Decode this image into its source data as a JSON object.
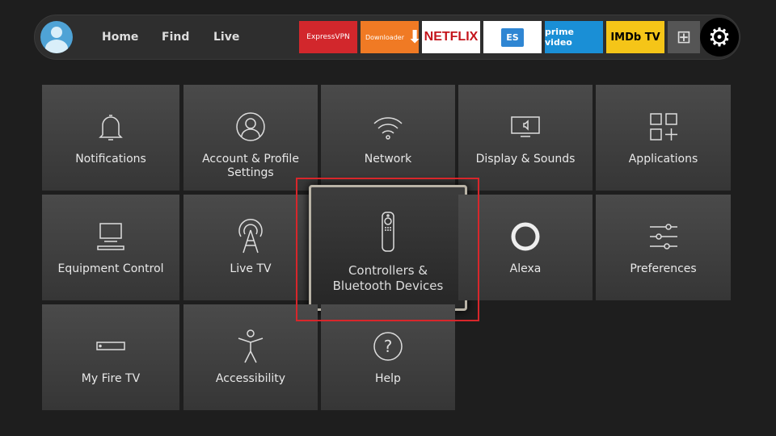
{
  "topbar": {
    "nav": [
      "Home",
      "Find",
      "Live"
    ],
    "apps": [
      {
        "label": "ExpressVPN",
        "bg": "#d2272c",
        "color": "#ffffff"
      },
      {
        "label": "Downloader",
        "bg": "#f07a24",
        "color": "#ffffff"
      },
      {
        "label": "NETFLIX",
        "bg": "#ffffff",
        "color": "#c4141b"
      },
      {
        "label": "ES",
        "bg": "#ffffff",
        "color": "#2f86d3"
      },
      {
        "label": "prime video",
        "bg": "#1a8fd6",
        "color": "#ffffff"
      },
      {
        "label": "IMDb TV",
        "bg": "#f5c518",
        "color": "#000000"
      }
    ],
    "app_grid_icon": "app-grid-plus-icon",
    "settings_icon": "gear-icon"
  },
  "tiles": [
    {
      "label": "Notifications",
      "icon": "bell-icon"
    },
    {
      "label": "Account & Profile Settings",
      "icon": "user-icon"
    },
    {
      "label": "Network",
      "icon": "wifi-icon"
    },
    {
      "label": "Display & Sounds",
      "icon": "tv-speaker-icon"
    },
    {
      "label": "Applications",
      "icon": "apps-icon"
    },
    {
      "label": "Equipment Control",
      "icon": "monitor-icon"
    },
    {
      "label": "Live TV",
      "icon": "antenna-icon"
    },
    {
      "label": "Controllers & Bluetooth Devices",
      "icon": "remote-icon",
      "focused": true
    },
    {
      "label": "Alexa",
      "icon": "alexa-ring-icon"
    },
    {
      "label": "Preferences",
      "icon": "sliders-icon"
    },
    {
      "label": "My Fire TV",
      "icon": "fire-tv-stick-icon"
    },
    {
      "label": "Accessibility",
      "icon": "accessibility-icon"
    },
    {
      "label": "Help",
      "icon": "question-icon"
    }
  ],
  "highlight_color": "#d8262b"
}
